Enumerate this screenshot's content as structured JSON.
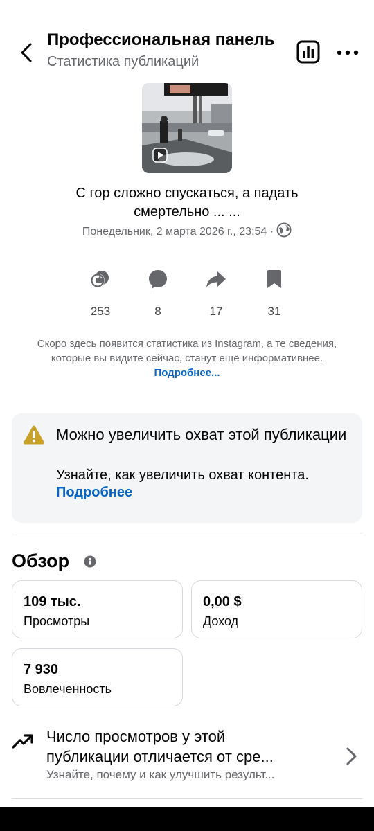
{
  "header": {
    "title": "Профессиональная панель",
    "subtitle": "Статистика публикаций",
    "icons": [
      "chevron-left-icon",
      "bar-chart-icon",
      "more-icon"
    ]
  },
  "post": {
    "caption_line1": "С гор сложно спускаться, а падать",
    "caption_line2": "смертельно ... ...",
    "date": "Понедельник, 2 марта 2026 г., 23:54 ·"
  },
  "metrics": [
    {
      "icon": "reactions-icon",
      "value": "253"
    },
    {
      "icon": "comment-icon",
      "value": "8"
    },
    {
      "icon": "share-icon",
      "value": "17"
    },
    {
      "icon": "bookmark-icon",
      "value": "31"
    }
  ],
  "notice": {
    "text": "Скоро здесь появится статистика из Instagram, а те сведения, которые вы видите сейчас, станут ещё информативнее. ",
    "link": "Подробнее..."
  },
  "reach_card": {
    "title": "Можно увеличить охват этой публикации",
    "text": "Узнайте, как увеличить охват контента. ",
    "link": "Подробнее"
  },
  "overview": {
    "title": "Обзор",
    "cards": [
      {
        "value": "109 тыс.",
        "label": "Просмотры"
      },
      {
        "value": "0,00 $",
        "label": "Доход"
      },
      {
        "value": "7 930",
        "label": "Вовлеченность"
      }
    ]
  },
  "insight": {
    "title_line1": "Число просмотров у этой",
    "title_line2": "публикации отличается от сре...",
    "subtitle": "Узнайте, почему и как улучшить результ..."
  },
  "colors": {
    "link": "#0a66c2",
    "warning": "#c9a227",
    "card_bg": "#f3f5f7",
    "secondary_text": "#65676b"
  }
}
